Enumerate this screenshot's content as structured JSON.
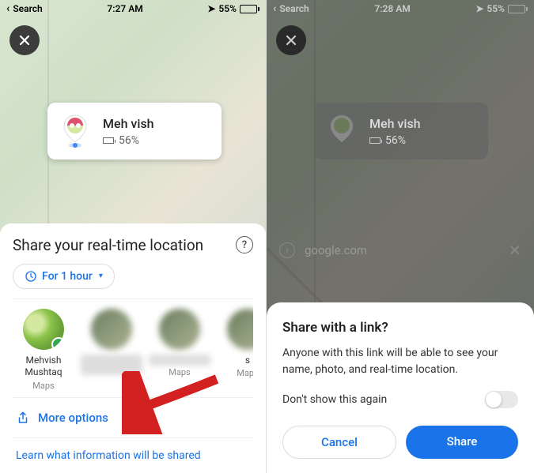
{
  "left": {
    "status": {
      "back": "Search",
      "time": "7:27 AM",
      "battery": "55%"
    },
    "location_card": {
      "name": "Meh vish",
      "battery": "56%"
    },
    "sheet": {
      "title": "Share your real-time location",
      "duration": "For 1 hour",
      "contacts": [
        {
          "name": "Mehvish Mushtaq",
          "sub": "Maps"
        },
        {
          "name": "",
          "sub": ""
        },
        {
          "name": "",
          "sub": "Maps"
        },
        {
          "name": "s",
          "sub": "Maps"
        }
      ],
      "more_options": "More options",
      "learn": "Learn what information will be shared"
    }
  },
  "right": {
    "status": {
      "back": "Search",
      "time": "7:28 AM",
      "battery": "55%"
    },
    "location_card": {
      "name": "Meh vish",
      "battery": "56%"
    },
    "url": "google.com",
    "dialog": {
      "title": "Share with a link?",
      "body": "Anyone with this link will be able to see your name, photo, and real-time location.",
      "dont_show": "Don't show this again",
      "cancel": "Cancel",
      "share": "Share"
    }
  }
}
